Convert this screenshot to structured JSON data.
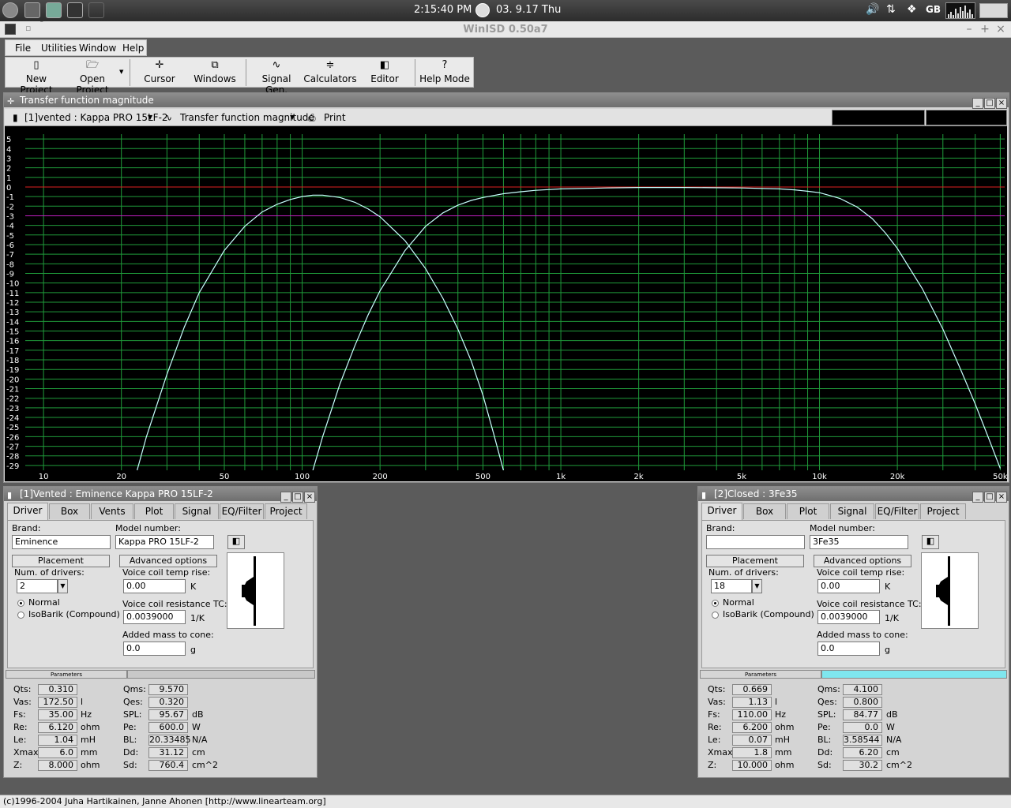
{
  "taskbar": {
    "time": "2:15:40 PM",
    "date": "03. 9.17 Thu",
    "layout": "GB"
  },
  "app": {
    "title": "WinISD 0.50a7",
    "status": "(c)1996-2004 Juha Hartikainen, Janne Ahonen [http://www.linearteam.org]"
  },
  "menu": [
    "File",
    "Utilities",
    "Window",
    "Help"
  ],
  "toolbar": [
    {
      "label": "New Project",
      "icon": "new-project-icon"
    },
    {
      "label": "Open Project",
      "icon": "open-project-icon"
    },
    {
      "label": "Cursor",
      "icon": "cursor-icon"
    },
    {
      "label": "Windows",
      "icon": "windows-icon"
    },
    {
      "label": "Signal Gen.",
      "icon": "signal-gen-icon"
    },
    {
      "label": "Calculators",
      "icon": "calculators-icon"
    },
    {
      "label": "Editor",
      "icon": "editor-icon"
    },
    {
      "label": "Help Mode",
      "icon": "help-mode-icon"
    }
  ],
  "chart_window": {
    "title": "Transfer function magnitude",
    "project_select": "[1]vented : Kappa PRO 15LF-2",
    "graph_select": "Transfer function magnitude",
    "print_label": "Print"
  },
  "chart_data": {
    "type": "line",
    "xscale": "log",
    "xlim": [
      8.5,
      52000
    ],
    "ylim": [
      -29.5,
      5.5
    ],
    "x_ticks": [
      10,
      20,
      50,
      100,
      200,
      500,
      1000,
      2000,
      5000,
      10000,
      20000,
      50000
    ],
    "x_tick_labels": [
      "10",
      "20",
      "50",
      "100",
      "200",
      "500",
      "1k",
      "2k",
      "5k",
      "10k",
      "20k",
      "50k"
    ],
    "y_ticks": [
      5,
      4,
      3,
      2,
      1,
      0,
      -1,
      -2,
      -3,
      -4,
      -5,
      -6,
      -7,
      -8,
      -9,
      -10,
      -11,
      -12,
      -13,
      -14,
      -15,
      -16,
      -17,
      -18,
      -19,
      -20,
      -21,
      -22,
      -23,
      -24,
      -25,
      -26,
      -27,
      -28,
      -29
    ],
    "grid": true,
    "reference_lines": [
      {
        "y": 0,
        "color": "#e02020"
      },
      {
        "y": -3,
        "color": "#c020c0"
      }
    ],
    "colors": {
      "background": "#000000",
      "grid": "#1f9a3a",
      "series": "#c8ffff"
    },
    "series": [
      {
        "x": [
          23,
          25,
          30,
          35,
          40,
          50,
          60,
          70,
          80,
          90,
          100,
          110,
          120,
          140,
          160,
          180,
          200,
          250,
          300,
          350,
          400,
          450,
          500,
          550,
          600
        ],
        "y": [
          -29.5,
          -26,
          -19.5,
          -14.6,
          -11,
          -6.6,
          -4.1,
          -2.6,
          -1.8,
          -1.3,
          -1.0,
          -0.85,
          -0.85,
          -1.1,
          -1.6,
          -2.3,
          -3.1,
          -5.6,
          -8.5,
          -11.6,
          -14.8,
          -18.1,
          -21.7,
          -25.7,
          -29.5
        ]
      },
      {
        "x": [
          110,
          120,
          140,
          160,
          180,
          200,
          250,
          300,
          350,
          400,
          450,
          500,
          600,
          700,
          800,
          1000,
          1500,
          2000,
          3000,
          5000,
          7000,
          8000,
          9000,
          10000,
          11000,
          12000,
          14000,
          16000,
          18000,
          20000,
          25000,
          30000,
          35000,
          40000,
          45000,
          50000
        ],
        "y": [
          -29.5,
          -26,
          -20.5,
          -16.5,
          -13.3,
          -10.8,
          -6.6,
          -4.1,
          -2.7,
          -1.9,
          -1.4,
          -1.1,
          -0.7,
          -0.5,
          -0.35,
          -0.2,
          -0.1,
          -0.05,
          -0.05,
          -0.1,
          -0.2,
          -0.3,
          -0.45,
          -0.6,
          -0.9,
          -1.2,
          -2.1,
          -3.3,
          -4.8,
          -6.4,
          -10.6,
          -14.8,
          -18.9,
          -22.6,
          -26.1,
          -29.3
        ]
      }
    ]
  },
  "panels": [
    {
      "title": "[1]Vented : Eminence  Kappa PRO 15LF-2",
      "tabs": [
        "Driver",
        "Box",
        "Vents",
        "Plot",
        "Signal",
        "EQ/Filter",
        "Project"
      ],
      "brand_label": "Brand:",
      "brand": "Eminence",
      "model_label": "Model number:",
      "model": "Kappa PRO 15LF-2",
      "placement_label": "Placement",
      "advanced_label": "Advanced options",
      "num_drivers_label": "Num. of drivers:",
      "num_drivers": "2",
      "vc_temp_label": "Voice coil temp rise:",
      "vc_temp": "0.00",
      "vc_temp_unit": "K",
      "vc_tc_label": "Voice coil resistance TC:",
      "vc_tc": "0.0039000",
      "vc_tc_unit": "1/K",
      "added_mass_label": "Added mass to cone:",
      "added_mass": "0.0",
      "added_mass_unit": "g",
      "normal_label": "Normal",
      "isobarik_label": "IsoBarik (Compound)",
      "params_label": "Parameters",
      "params_fill": 0,
      "params_left": [
        {
          "label": "Qts:",
          "value": "0.310",
          "unit": ""
        },
        {
          "label": "Vas:",
          "value": "172.50",
          "unit": "l"
        },
        {
          "label": "Fs:",
          "value": "35.00",
          "unit": "Hz"
        },
        {
          "label": "Re:",
          "value": "6.120",
          "unit": "ohm"
        },
        {
          "label": "Le:",
          "value": "1.04",
          "unit": "mH"
        },
        {
          "label": "Xmax:",
          "value": "6.0",
          "unit": "mm"
        },
        {
          "label": "Z:",
          "value": "8.000",
          "unit": "ohm"
        }
      ],
      "params_right": [
        {
          "label": "Qms:",
          "value": "9.570",
          "unit": ""
        },
        {
          "label": "Qes:",
          "value": "0.320",
          "unit": ""
        },
        {
          "label": "SPL:",
          "value": "95.67",
          "unit": "dB"
        },
        {
          "label": "Pe:",
          "value": "600.0",
          "unit": "W"
        },
        {
          "label": "BL:",
          "value": "20.33485",
          "unit": "N/A"
        },
        {
          "label": "Dd:",
          "value": "31.12",
          "unit": "cm"
        },
        {
          "label": "Sd:",
          "value": "760.4",
          "unit": "cm^2"
        }
      ]
    },
    {
      "title": "[2]Closed : 3Fe35",
      "tabs": [
        "Driver",
        "Box",
        "Plot",
        "Signal",
        "EQ/Filter",
        "Project"
      ],
      "brand_label": "Brand:",
      "brand": "",
      "model_label": "Model number:",
      "model": "3Fe35",
      "placement_label": "Placement",
      "advanced_label": "Advanced options",
      "num_drivers_label": "Num. of drivers:",
      "num_drivers": "18",
      "vc_temp_label": "Voice coil temp rise:",
      "vc_temp": "0.00",
      "vc_temp_unit": "K",
      "vc_tc_label": "Voice coil resistance TC:",
      "vc_tc": "0.0039000",
      "vc_tc_unit": "1/K",
      "added_mass_label": "Added mass to cone:",
      "added_mass": "0.0",
      "added_mass_unit": "g",
      "normal_label": "Normal",
      "isobarik_label": "IsoBarik (Compound)",
      "params_label": "Parameters",
      "params_fill": 1,
      "params_left": [
        {
          "label": "Qts:",
          "value": "0.669",
          "unit": ""
        },
        {
          "label": "Vas:",
          "value": "1.13",
          "unit": "l"
        },
        {
          "label": "Fs:",
          "value": "110.00",
          "unit": "Hz"
        },
        {
          "label": "Re:",
          "value": "6.200",
          "unit": "ohm"
        },
        {
          "label": "Le:",
          "value": "0.07",
          "unit": "mH"
        },
        {
          "label": "Xmax:",
          "value": "1.8",
          "unit": "mm"
        },
        {
          "label": "Z:",
          "value": "10.000",
          "unit": "ohm"
        }
      ],
      "params_right": [
        {
          "label": "Qms:",
          "value": "4.100",
          "unit": ""
        },
        {
          "label": "Qes:",
          "value": "0.800",
          "unit": ""
        },
        {
          "label": "SPL:",
          "value": "84.77",
          "unit": "dB"
        },
        {
          "label": "Pe:",
          "value": "0.0",
          "unit": "W"
        },
        {
          "label": "BL:",
          "value": "3.58544",
          "unit": "N/A"
        },
        {
          "label": "Dd:",
          "value": "6.20",
          "unit": "cm"
        },
        {
          "label": "Sd:",
          "value": "30.2",
          "unit": "cm^2"
        }
      ]
    }
  ]
}
